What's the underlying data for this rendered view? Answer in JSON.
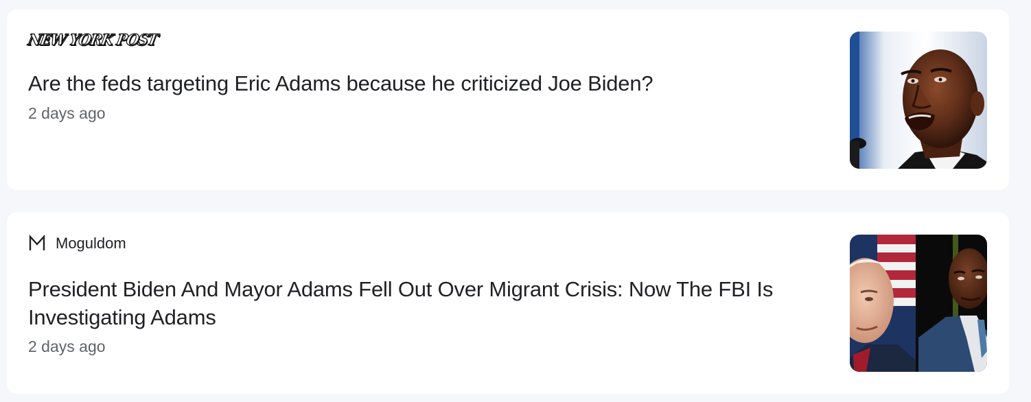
{
  "articles": [
    {
      "source": "NEW YORK POST",
      "source_style": "logo",
      "headline": "Are the feds targeting Eric Adams because he criticized Joe Biden?",
      "time": "2 days ago",
      "thumbnail": "portrait-man-speaking"
    },
    {
      "source": "Moguldom",
      "source_icon": "M",
      "headline": "President Biden And Mayor Adams Fell Out Over Migrant Crisis: Now The FBI Is Investigating Adams",
      "time": "2 days ago",
      "thumbnail": "two-men-split-photo"
    }
  ],
  "colors": {
    "page_background": "#f6f7fa",
    "card_background": "#ffffff",
    "headline": "#202124",
    "timestamp": "#5f6368"
  }
}
